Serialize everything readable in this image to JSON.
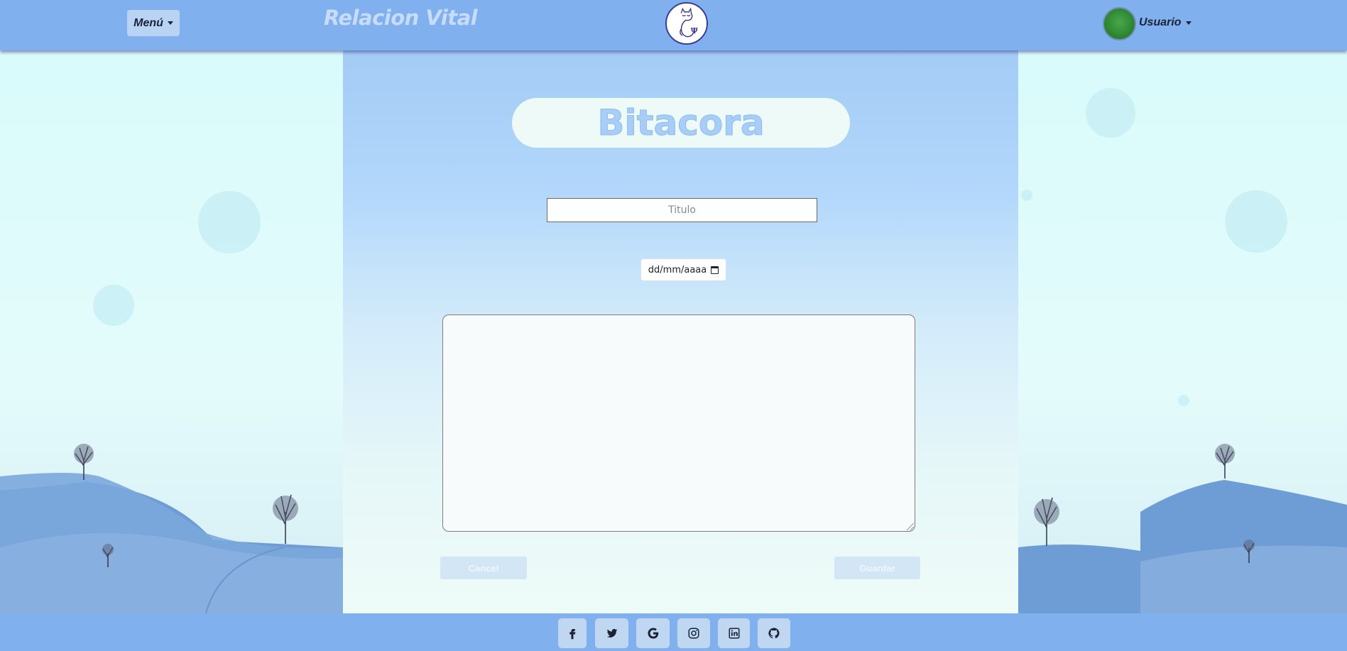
{
  "header": {
    "menu_label": "Menú",
    "brand": "Relacion Vital",
    "user_label": "Usuario"
  },
  "form": {
    "title_heading": "Bitacora",
    "title_placeholder": "Titulo",
    "date_placeholder": "dd/mm/aaaa",
    "textarea_value": "",
    "cancel_label": "Cancel",
    "save_label": "Guardar"
  },
  "footer": {
    "social": [
      {
        "icon": "facebook-icon"
      },
      {
        "icon": "twitter-icon"
      },
      {
        "icon": "google-icon"
      },
      {
        "icon": "instagram-icon"
      },
      {
        "icon": "linkedin-icon"
      },
      {
        "icon": "github-icon"
      }
    ]
  },
  "colors": {
    "header_bg": "#80b1ee",
    "panel_top": "#a3cbf4",
    "panel_bottom": "#eefcf8",
    "heading_text": "#a8cdf7"
  }
}
